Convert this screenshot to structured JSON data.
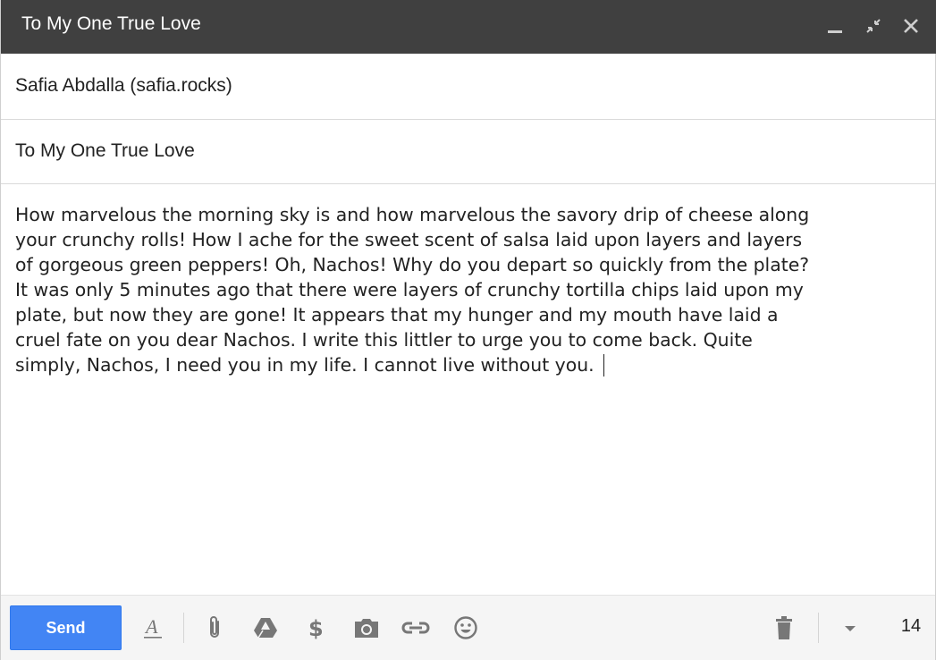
{
  "window": {
    "title": "To My One True Love",
    "controls": {
      "minimize": "minimize-icon",
      "exit_fullscreen": "exit-fullscreen-icon",
      "close": "close-icon"
    }
  },
  "compose": {
    "recipient": "Safia Abdalla (safia.rocks)",
    "subject": "To My One True Love",
    "body_lines": [
      "How marvelous the morning sky is and how marvelous the savory drip of cheese along",
      "your crunchy rolls! How I ache for the sweet scent of salsa laid upon layers and layers",
      "of gorgeous green peppers! Oh, Nachos! Why do you depart so quickly from the plate?",
      "It was only 5 minutes ago that there were layers of crunchy tortilla chips laid upon my",
      "plate, but now they are gone! It appears that my hunger and my mouth have laid a",
      "cruel fate on you dear Nachos. I write this littler to urge you to come back. Quite",
      "simply, Nachos, I need you in my life. I cannot live without you. "
    ]
  },
  "toolbar": {
    "send_label": "Send",
    "tools": [
      "formatting-icon",
      "attach-icon",
      "drive-icon",
      "money-icon",
      "photo-icon",
      "link-icon",
      "emoji-icon",
      "trash-icon",
      "more-options-icon"
    ],
    "trailing_value": "14"
  },
  "colors": {
    "titlebar": "#404040",
    "send_button": "#4285f4",
    "toolbar_bg": "#f5f5f5",
    "icon": "#777777"
  }
}
